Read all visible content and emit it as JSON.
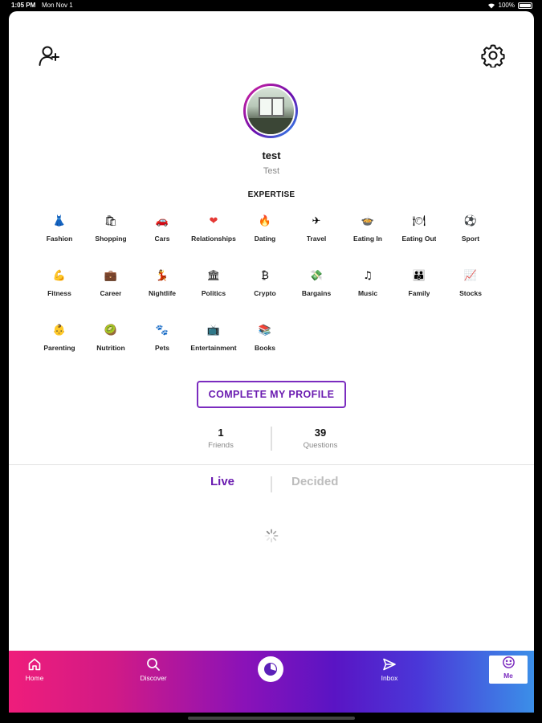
{
  "status_bar": {
    "time": "1:05 PM",
    "date": "Mon Nov 1",
    "battery": "100%"
  },
  "profile": {
    "username": "test",
    "display_name": "Test"
  },
  "expertise": {
    "heading": "EXPERTISE",
    "items": [
      {
        "emoji": "👗",
        "label": "Fashion"
      },
      {
        "emoji": "🛍",
        "label": "Shopping"
      },
      {
        "emoji": "🚗",
        "label": "Cars"
      },
      {
        "emoji": "❤",
        "label": "Relationships"
      },
      {
        "emoji": "🔥",
        "label": "Dating"
      },
      {
        "emoji": "✈",
        "label": "Travel"
      },
      {
        "emoji": "🍲",
        "label": "Eating In"
      },
      {
        "emoji": "🍽",
        "label": "Eating Out"
      },
      {
        "emoji": "⚽",
        "label": "Sport"
      },
      {
        "emoji": "💪",
        "label": "Fitness"
      },
      {
        "emoji": "💼",
        "label": "Career"
      },
      {
        "emoji": "💃",
        "label": "Nightlife"
      },
      {
        "emoji": "🏛",
        "label": "Politics"
      },
      {
        "emoji": "₿",
        "label": "Crypto"
      },
      {
        "emoji": "💸",
        "label": "Bargains"
      },
      {
        "emoji": "♫",
        "label": "Music"
      },
      {
        "emoji": "👪",
        "label": "Family"
      },
      {
        "emoji": "📈",
        "label": "Stocks"
      },
      {
        "emoji": "👶",
        "label": "Parenting"
      },
      {
        "emoji": "🥝",
        "label": "Nutrition"
      },
      {
        "emoji": "🐾",
        "label": "Pets"
      },
      {
        "emoji": "📺",
        "label": "Entertainment"
      },
      {
        "emoji": "📚",
        "label": "Books"
      }
    ]
  },
  "complete_profile_label": "COMPLETE MY PROFILE",
  "stats": {
    "friends": {
      "value": "1",
      "label": "Friends"
    },
    "questions": {
      "value": "39",
      "label": "Questions"
    }
  },
  "tabs": {
    "live": "Live",
    "decided": "Decided"
  },
  "bottom_nav": {
    "home": "Home",
    "discover": "Discover",
    "inbox": "Inbox",
    "me": "Me"
  },
  "colors": {
    "accent": "#7b2cbf",
    "gradient_start": "#ef1d7b",
    "gradient_end": "#3b8fe8"
  },
  "icons": {
    "add_friend": "add-person-icon",
    "settings": "gear-icon",
    "home": "home-icon",
    "discover": "search-icon",
    "center": "app-logo-icon",
    "inbox": "send-icon",
    "me": "smiley-icon"
  }
}
